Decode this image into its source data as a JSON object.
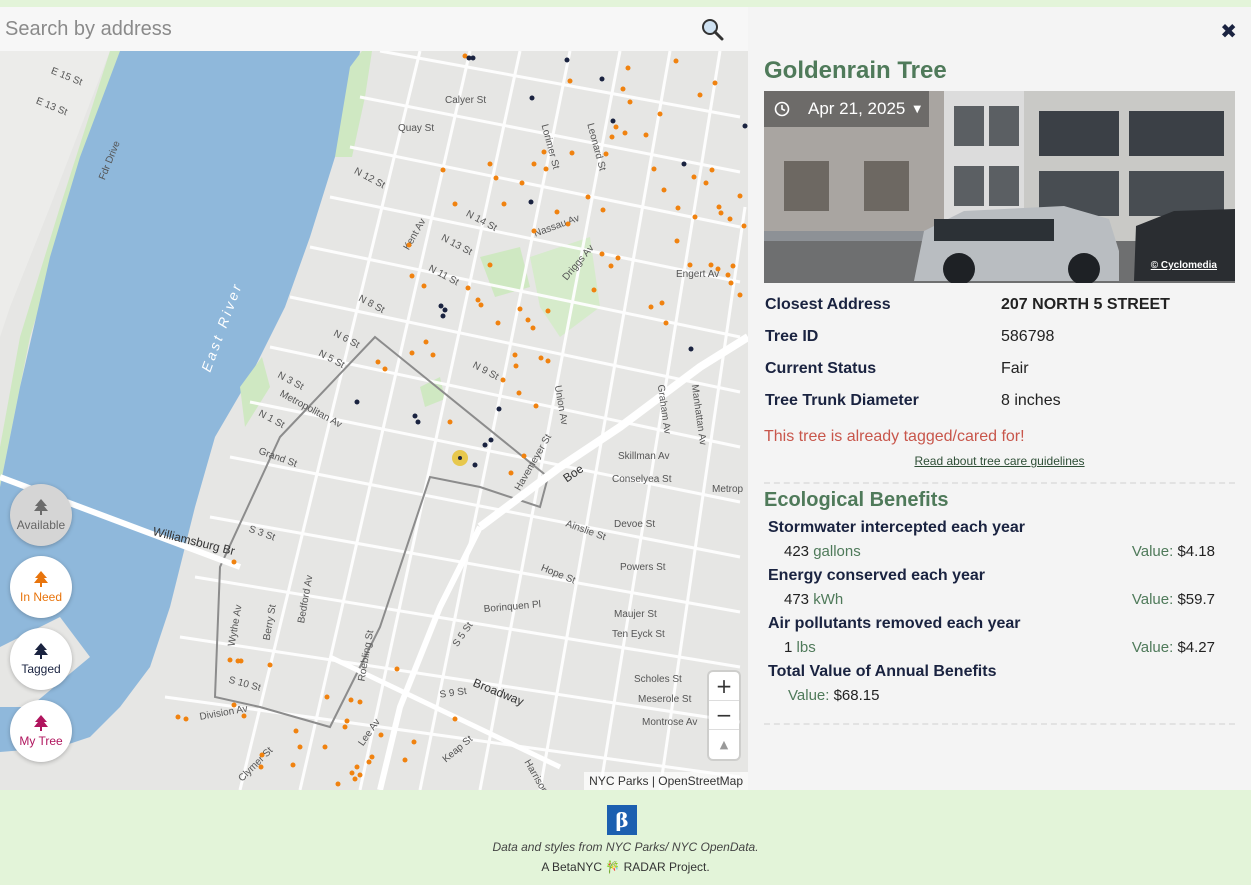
{
  "search": {
    "placeholder": "Search by address"
  },
  "map": {
    "attribution": "NYC Parks | OpenStreetMap",
    "labels": {
      "river": "East River",
      "fdr": "Fdr Drive",
      "williamsburg_br": "Williamsburg Br",
      "broadway": "Broadway",
      "boe": "Boe",
      "kent_av": "Kent Av",
      "metropolitan_av": "Metropolitan Av",
      "union_av": "Union Av",
      "havemeyer_st": "Havemeyer St",
      "n12": "N 12 St",
      "n11": "N 11 St",
      "n9": "N 9 St",
      "n8": "N 8 St",
      "n6": "N 6 St",
      "n5": "N 5 St",
      "n3": "N 3 St",
      "n1": "N 1 St",
      "grand_st": "Grand St",
      "s3": "S 3 St",
      "s5": "S 5 St",
      "s9": "S 9 St",
      "division_av": "Division Av",
      "skillman_av": "Skillman Av",
      "conselyea_st": "Conselyea St",
      "devoe_st": "Devoe St",
      "powers_st": "Powers St",
      "maujer_st": "Maujer St",
      "ten_eyck": "Ten Eyck St",
      "scholes": "Scholes St",
      "meserole": "Meserole St",
      "montrose": "Montrose Av",
      "borinquen": "Borinquen Pl",
      "driggs_av": "Driggs Av",
      "bedford_av": "Bedford Av",
      "berry_st": "Berry St",
      "wythe_av": "Wythe Av",
      "roebling": "Roebling St",
      "lee_av": "Lee Av",
      "keap": "Keap St",
      "harrison": "Harrison Av",
      "nassau_av": "Nassau Av",
      "engert_av": "Engert Av",
      "calyer": "Calyer St",
      "quay": "Quay St",
      "e15": "E 15 St",
      "e13": "E 13 St",
      "metrop2": "Metrop",
      "manhattan_av": "Manhattan Av",
      "graham_av": "Graham Av",
      "leonard_st": "Leonard St",
      "lorimer_st": "Lorimer St",
      "clymer": "Clymer St",
      "s10": "S 10 St",
      "hope_st": "Hope St",
      "ainslie": "Ainslie St",
      "n13": "N 13 St",
      "n14": "N 14 St"
    },
    "zoom_in": "+",
    "zoom_out": "−",
    "reset_north": "▲"
  },
  "legend": [
    {
      "label": "Available",
      "color": "#666666"
    },
    {
      "label": "In Need",
      "color": "#e8740c"
    },
    {
      "label": "Tagged",
      "color": "#1a2340"
    },
    {
      "label": "My Tree",
      "color": "#b0155e"
    }
  ],
  "panel": {
    "close": "✖",
    "title": "Goldenrain Tree",
    "photo_date": "Apr 21, 2025",
    "photo_credit": "© Cyclomedia",
    "info": [
      {
        "key": "Closest Address",
        "value": "207 NORTH 5 STREET"
      },
      {
        "key": "Tree ID",
        "value": "586798"
      },
      {
        "key": "Current Status",
        "value": "Fair"
      },
      {
        "key": "Tree Trunk Diameter",
        "value": "8 inches"
      }
    ],
    "tagged_message": "This tree is already tagged/cared for!",
    "care_link": "Read about tree care guidelines",
    "eco_title": "Ecological Benefits",
    "benefits": [
      {
        "title": "Stormwater intercepted each year",
        "amount": "423",
        "unit": "gallons",
        "value_label": "Value:",
        "value": "$4.18"
      },
      {
        "title": "Energy conserved each year",
        "amount": "473",
        "unit": "kWh",
        "value_label": "Value:",
        "value": "$59.7"
      },
      {
        "title": "Air pollutants removed each year",
        "amount": "1",
        "unit": "lbs",
        "value_label": "Value:",
        "value": "$4.27"
      }
    ],
    "total": {
      "title": "Total Value of Annual Benefits",
      "value_label": "Value:",
      "value": "$68.15"
    }
  },
  "footer": {
    "logo": "β",
    "line1": "Data and styles from NYC Parks/ NYC OpenData.",
    "line2": "A BetaNYC 🎋 RADAR Project."
  }
}
